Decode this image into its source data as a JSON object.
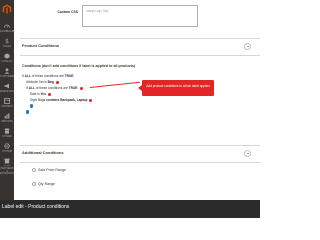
{
  "sidebar": {
    "items": [
      {
        "label": "DASHBOARD",
        "icon": "dashboard-icon"
      },
      {
        "label": "SALES",
        "icon": "dollar-icon"
      },
      {
        "label": "CATALOG",
        "icon": "cube-icon"
      },
      {
        "label": "CUSTOMERS",
        "icon": "user-icon"
      },
      {
        "label": "MARKETING",
        "icon": "megaphone-icon"
      },
      {
        "label": "CONTENT",
        "icon": "layout-icon"
      },
      {
        "label": "REPORTS",
        "icon": "bar-chart-icon"
      },
      {
        "label": "STORES",
        "icon": "store-icon"
      },
      {
        "label": "SYSTEM",
        "icon": "gear-icon"
      },
      {
        "label": "FIND PARTNERS & EXTENSIONS",
        "icon": "box-icon"
      }
    ]
  },
  "custom_css": {
    "label": "Custom CSS",
    "placeholder": "margin-top: 5px;"
  },
  "product_conditions": {
    "title": "Product Conditions",
    "conditions_title": "Conditions (don't add conditions if label is applied to all products)",
    "rules": {
      "line1_prefix": "If",
      "line1_agg": "ALL",
      "line1_mid": "of these conditions are",
      "line1_val": "TRUE",
      "line2_prefix": "Attribute Set is",
      "line2_val": "Bag",
      "line3_prefix": "If",
      "line3_agg": "ALL",
      "line3_mid": "of these conditions are",
      "line3_val": "TRUE",
      "line4_prefix": "Sale is",
      "line4_val": "Yes",
      "line5_prefix": "Style Bags",
      "line5_op": "contains",
      "line5_val": "Backpack, Laptop"
    },
    "tooltip": "Add product conditions to which label applies"
  },
  "additional_conditions": {
    "title": "Additional Conditions",
    "items": [
      "Sale Price Range",
      "Qty Range"
    ]
  },
  "footer": {
    "text": "Label edit - Product conditions"
  },
  "colors": {
    "sidebar": "#373330",
    "accent_red": "#e22626",
    "add_blue": "#1979c3",
    "footer": "#2b2b2b",
    "logo": "#eb5202"
  }
}
